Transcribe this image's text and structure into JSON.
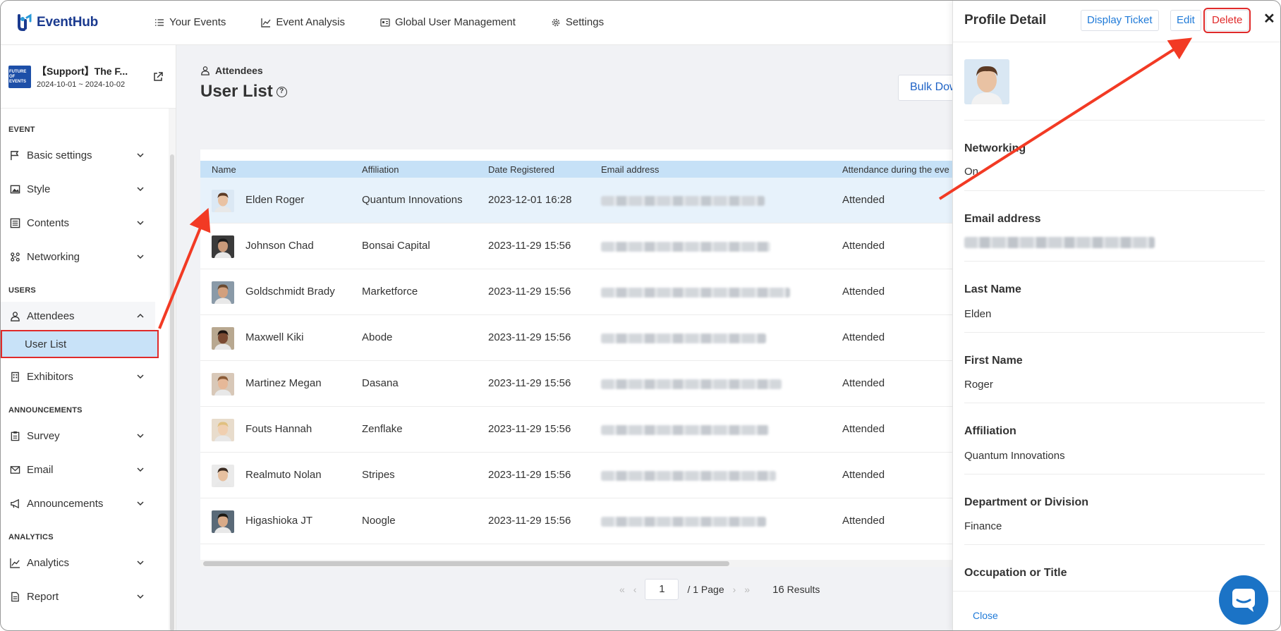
{
  "app": {
    "logo_text": "EventHub"
  },
  "topnav": {
    "items": [
      {
        "label": "Your Events",
        "icon": "list-icon"
      },
      {
        "label": "Event Analysis",
        "icon": "chart-icon"
      },
      {
        "label": "Global User Management",
        "icon": "id-card-icon"
      },
      {
        "label": "Settings",
        "icon": "gear-icon"
      }
    ]
  },
  "event": {
    "name": "【Support】The F...",
    "dates": "2024-10-01 ~ 2024-10-02",
    "thumb_text": "FUTURE OF EVENTS"
  },
  "sidebar": {
    "sections": {
      "event": "EVENT",
      "users": "USERS",
      "announcements": "ANNOUNCEMENTS",
      "analytics": "ANALYTICS"
    },
    "items": {
      "basic_settings": "Basic settings",
      "style": "Style",
      "contents": "Contents",
      "networking": "Networking",
      "attendees": "Attendees",
      "user_list": "User List",
      "exhibitors": "Exhibitors",
      "survey": "Survey",
      "email": "Email",
      "announcements": "Announcements",
      "analytics": "Analytics",
      "report": "Report"
    }
  },
  "main": {
    "breadcrumb": "Attendees",
    "title": "User List",
    "help": "?",
    "bulk_button": "Bulk Dow",
    "table": {
      "headers": [
        "Name",
        "Affiliation",
        "Date Registered",
        "Email address",
        "Attendance during the eve"
      ],
      "rows": [
        {
          "name": "Elden Roger",
          "affiliation": "Quantum Innovations",
          "date": "2023-12-01 16:28",
          "attendance": "Attended"
        },
        {
          "name": "Johnson Chad",
          "affiliation": "Bonsai Capital",
          "date": "2023-11-29 15:56",
          "attendance": "Attended"
        },
        {
          "name": "Goldschmidt Brady",
          "affiliation": "Marketforce",
          "date": "2023-11-29 15:56",
          "attendance": "Attended"
        },
        {
          "name": "Maxwell Kiki",
          "affiliation": "Abode",
          "date": "2023-11-29 15:56",
          "attendance": "Attended"
        },
        {
          "name": "Martinez Megan",
          "affiliation": "Dasana",
          "date": "2023-11-29 15:56",
          "attendance": "Attended"
        },
        {
          "name": "Fouts Hannah",
          "affiliation": "Zenflake",
          "date": "2023-11-29 15:56",
          "attendance": "Attended"
        },
        {
          "name": "Realmuto Nolan",
          "affiliation": "Stripes",
          "date": "2023-11-29 15:56",
          "attendance": "Attended"
        },
        {
          "name": "Higashioka JT",
          "affiliation": "Noogle",
          "date": "2023-11-29 15:56",
          "attendance": "Attended"
        }
      ]
    },
    "pager": {
      "current": "1",
      "of_pages": "/ 1 Page",
      "results_count": "16",
      "results_label": "Results"
    }
  },
  "panel": {
    "title": "Profile Detail",
    "display_ticket": "Display Ticket",
    "edit": "Edit",
    "delete": "Delete",
    "close_x": "✕",
    "fields": {
      "networking_label": "Networking",
      "networking_value": "On",
      "email_label": "Email address",
      "last_name_label": "Last Name",
      "last_name_value": "Elden",
      "first_name_label": "First Name",
      "first_name_value": "Roger",
      "affiliation_label": "Affiliation",
      "affiliation_value": "Quantum Innovations",
      "department_label": "Department or Division",
      "department_value": "Finance",
      "occupation_label": "Occupation or Title"
    },
    "close_link": "Close"
  },
  "colors": {
    "brand": "#1a3a8f",
    "link": "#1f7ad8",
    "danger": "#e02a2a",
    "table_header": "#c6e1f7",
    "selected_row": "#e7f2fb",
    "chat": "#1b73c6"
  }
}
